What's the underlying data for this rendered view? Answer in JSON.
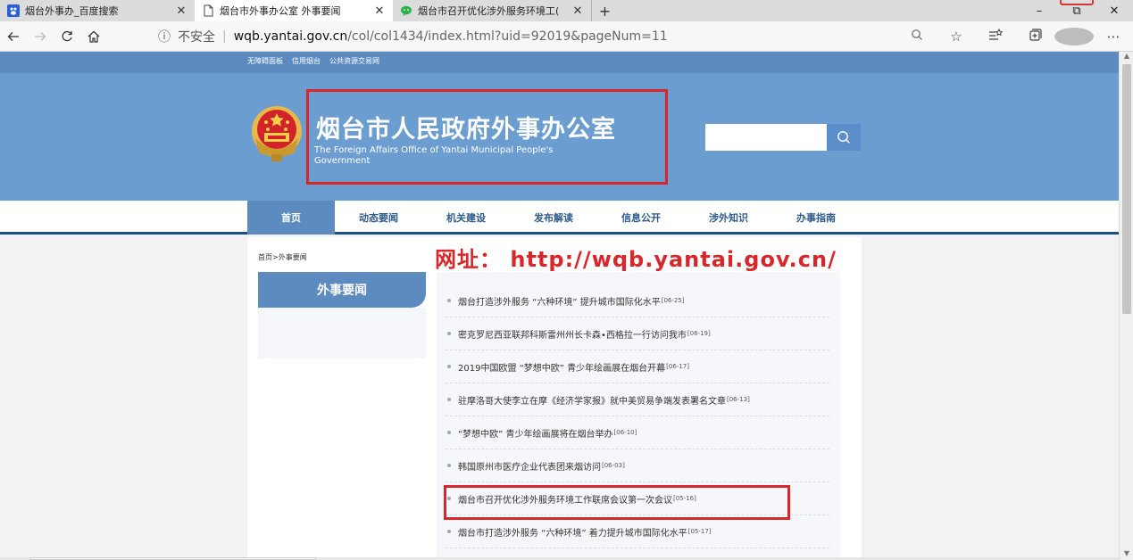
{
  "tabs": [
    {
      "label": "烟台外事办_百度搜索",
      "close": "✕"
    },
    {
      "label": "烟台市外事办公室 外事要闻",
      "close": "✕"
    },
    {
      "label": "烟台市召开优化涉外服务环境工(",
      "close": "✕"
    }
  ],
  "newtab_symbol": "+",
  "window_controls": {
    "minimize": "–",
    "restore": "⧉",
    "close": "✕"
  },
  "address": {
    "insecure_label": "不安全",
    "domain": "wqb.yantai.gov.cn",
    "path": "/col/col1434/index.html?uid=92019&pageNum=11"
  },
  "site": {
    "top_links": [
      "无障碍面板",
      "信用烟台",
      "公共资源交易网"
    ],
    "title": "烟台市人民政府外事办公室",
    "subtitle": "The Foreign Affairs Office of Yantai Municipal People's Government",
    "nav": [
      "首页",
      "动态要闻",
      "机关建设",
      "发布解读",
      "信息公开",
      "涉外知识",
      "办事指南"
    ],
    "breadcrumb": "首页>外事要闻",
    "url_note": "网址： http://wqb.yantai.gov.cn/",
    "sidebar_heading": "外事要闻"
  },
  "news": [
    {
      "title": "烟台打造涉外服务 “六种环境” 提升城市国际化水平",
      "date": "[06-25]"
    },
    {
      "title": "密克罗尼西亚联邦科斯雷州州长卡森•西格拉一行访问我市",
      "date": "[06-19]"
    },
    {
      "title": "2019中国欧盟 “梦想中欧” 青少年绘画展在烟台开幕",
      "date": "[06-17]"
    },
    {
      "title": "驻摩洛哥大使李立在摩《经济学家报》就中美贸易争端发表署名文章",
      "date": "[06-13]"
    },
    {
      "title": "“梦想中欧” 青少年绘画展将在烟台举办",
      "date": "[06-10]"
    },
    {
      "title": "韩国原州市医疗企业代表团来烟访问",
      "date": "[06-03]"
    },
    {
      "title": "烟台市召开优化涉外服务环境工作联席会议第一次会议",
      "date": "[05-16]"
    },
    {
      "title": "烟台市打造涉外服务 “六种环境” 着力提升城市国际化水平",
      "date": "[05-17]"
    }
  ],
  "colors": {
    "banner": "#6c9dd0",
    "nav_active": "#5c8bc0",
    "highlight": "#d7272b"
  }
}
